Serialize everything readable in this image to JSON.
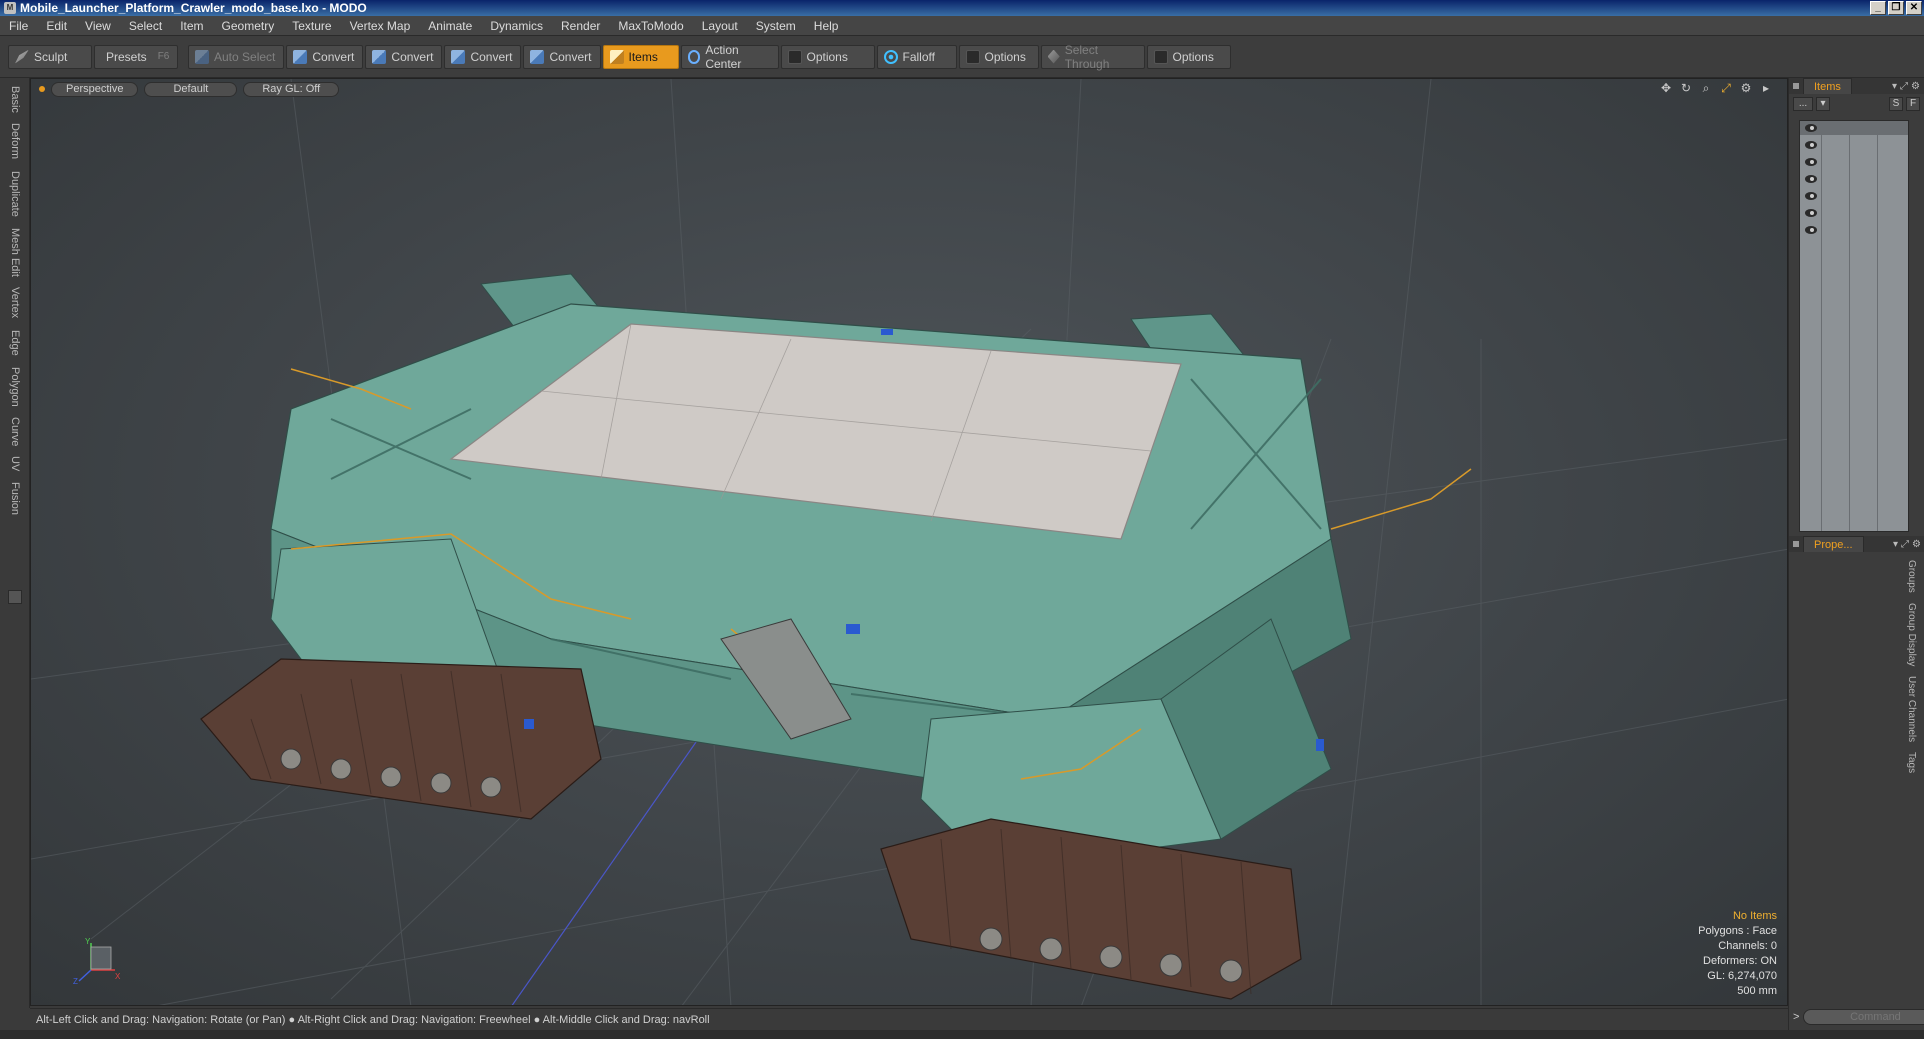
{
  "window": {
    "title": "Mobile_Launcher_Platform_Crawler_modo_base.lxo - MODO",
    "minimize": "_",
    "restore": "❐",
    "close": "✕"
  },
  "menu": [
    "File",
    "Edit",
    "View",
    "Select",
    "Item",
    "Geometry",
    "Texture",
    "Vertex Map",
    "Animate",
    "Dynamics",
    "Render",
    "MaxToModo",
    "Layout",
    "System",
    "Help"
  ],
  "toolbar": {
    "sculpt": "Sculpt",
    "presets": "Presets",
    "presets_hint": "F6",
    "auto_select": "Auto Select",
    "convert_1": "Convert",
    "convert_2": "Convert",
    "convert_3": "Convert",
    "convert_4": "Convert",
    "items": "Items",
    "action_center": "Action Center",
    "options_1": "Options",
    "falloff": "Falloff",
    "options_2": "Options",
    "select_through": "Select Through",
    "options_3": "Options"
  },
  "left_tabs": [
    "Basic",
    "Deform",
    "Duplicate",
    "Mesh Edit",
    "Vertex",
    "Edge",
    "Polygon",
    "Curve",
    "UV",
    "Fusion"
  ],
  "viewport": {
    "view_mode": "Perspective",
    "shading": "Default",
    "ray_gl": "Ray GL: Off",
    "stats": {
      "selection": "No Items",
      "polygons": "Polygons : Face",
      "channels": "Channels: 0",
      "deformers": "Deformers: ON",
      "gl": "GL: 6,274,070",
      "scale": "500 mm"
    },
    "axis": {
      "x": "X",
      "y": "Y",
      "z": "Z"
    }
  },
  "status_bar": "Alt-Left Click and Drag: Navigation: Rotate (or Pan) ● Alt-Right Click and Drag: Navigation: Freewheel ● Alt-Middle Click and Drag: navRoll",
  "right_panel": {
    "items_tab": "Items",
    "properties_tab": "Prope...",
    "dots_button": "...",
    "s_button": "S",
    "f_button": "F",
    "vertical_tabs": [
      "Groups",
      "Group Display",
      "User Channels",
      "Tags"
    ],
    "command_placeholder": "Command",
    "command_arrow": ">"
  },
  "colors": {
    "accent": "#e89a1e",
    "model_body": "#6fa89a",
    "track": "#5a3f35",
    "deck": "#cfcac6"
  }
}
